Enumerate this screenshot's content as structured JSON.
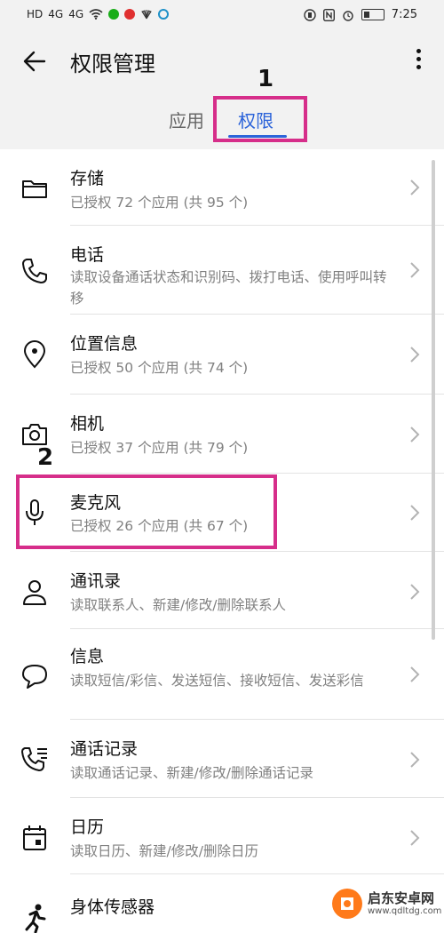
{
  "status_bar": {
    "left_indicators": [
      "HD",
      "4G",
      "4G",
      "wifi",
      "app",
      "app",
      "app",
      "app"
    ],
    "time": "7:25"
  },
  "header": {
    "title": "权限管理",
    "tabs": [
      {
        "label": "应用",
        "selected": false
      },
      {
        "label": "权限",
        "selected": true
      }
    ]
  },
  "annotations": {
    "label_1": "1",
    "label_2": "2",
    "color": "#d62e8a"
  },
  "permissions": [
    {
      "icon": "folder-icon",
      "title": "存储",
      "subtitle": "已授权 72 个应用 (共 95 个)"
    },
    {
      "icon": "phone-icon",
      "title": "电话",
      "subtitle": "读取设备通话状态和识别码、拨打电话、使用呼叫转移"
    },
    {
      "icon": "location-pin-icon",
      "title": "位置信息",
      "subtitle": "已授权 50 个应用 (共 74 个)"
    },
    {
      "icon": "camera-icon",
      "title": "相机",
      "subtitle": "已授权 37 个应用 (共 79 个)"
    },
    {
      "icon": "microphone-icon",
      "title": "麦克风",
      "subtitle": "已授权 26 个应用 (共 67 个)"
    },
    {
      "icon": "contact-icon",
      "title": "通讯录",
      "subtitle": "读取联系人、新建/修改/删除联系人"
    },
    {
      "icon": "message-bubble-icon",
      "title": "信息",
      "subtitle": "读取短信/彩信、发送短信、接收短信、发送彩信"
    },
    {
      "icon": "call-log-icon",
      "title": "通话记录",
      "subtitle": "读取通话记录、新建/修改/删除通话记录"
    },
    {
      "icon": "calendar-icon",
      "title": "日历",
      "subtitle": "读取日历、新建/修改/删除日历"
    },
    {
      "icon": "running-person-icon",
      "title": "身体传感器",
      "subtitle": ""
    }
  ],
  "watermark": {
    "name": "启东安卓网",
    "url": "www.qdltdg.com"
  },
  "colors": {
    "accent": "#2b63d9",
    "header_bg": "#f2f2f2",
    "subtitle": "#808080"
  }
}
